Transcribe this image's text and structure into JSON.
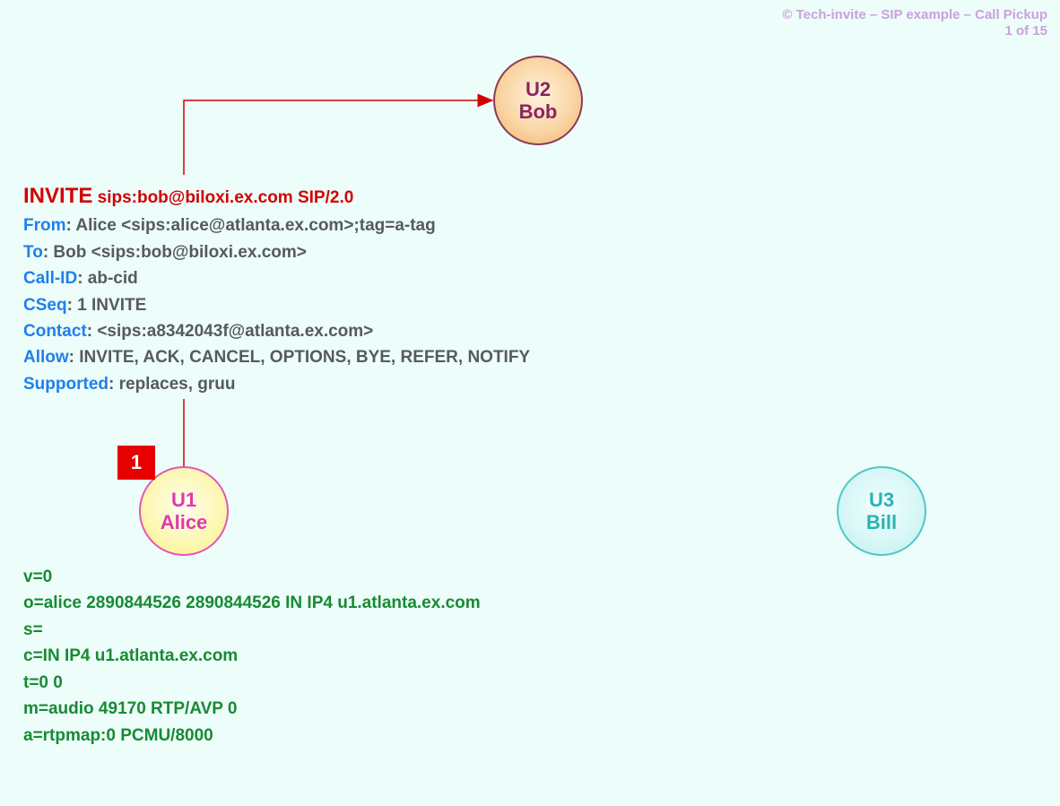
{
  "header": {
    "credit": "© Tech-invite – SIP example – Call Pickup",
    "page": "1 of 15"
  },
  "step": {
    "number": "1"
  },
  "nodes": {
    "u2": {
      "id": "U2",
      "name": "Bob"
    },
    "u1": {
      "id": "U1",
      "name": "Alice"
    },
    "u3": {
      "id": "U3",
      "name": "Bill"
    }
  },
  "sip": {
    "method": "INVITE",
    "request_line_rest": "sips:bob@biloxi.ex.com SIP/2.0",
    "headers": {
      "from_label": "From",
      "from_value": ": Alice <sips:alice@atlanta.ex.com>;tag=a-tag",
      "to_label": "To",
      "to_value": ": Bob <sips:bob@biloxi.ex.com>",
      "callid_label": "Call-ID",
      "callid_value": ": ab-cid",
      "cseq_label": "CSeq",
      "cseq_value": ": 1 INVITE",
      "contact_label": "Contact",
      "contact_value": ": <sips:a8342043f@atlanta.ex.com>",
      "allow_label": "Allow",
      "allow_value": ": INVITE, ACK, CANCEL, OPTIONS, BYE, REFER, NOTIFY",
      "supported_label": "Supported",
      "supported_value": ": replaces, gruu"
    }
  },
  "sdp": {
    "v": "v=0",
    "o": "o=alice  2890844526  2890844526  IN  IP4  u1.atlanta.ex.com",
    "s": "s=",
    "c": "c=IN  IP4  u1.atlanta.ex.com",
    "t": "t=0  0",
    "m": "m=audio  49170  RTP/AVP  0",
    "a": "a=rtpmap:0  PCMU/8000"
  }
}
